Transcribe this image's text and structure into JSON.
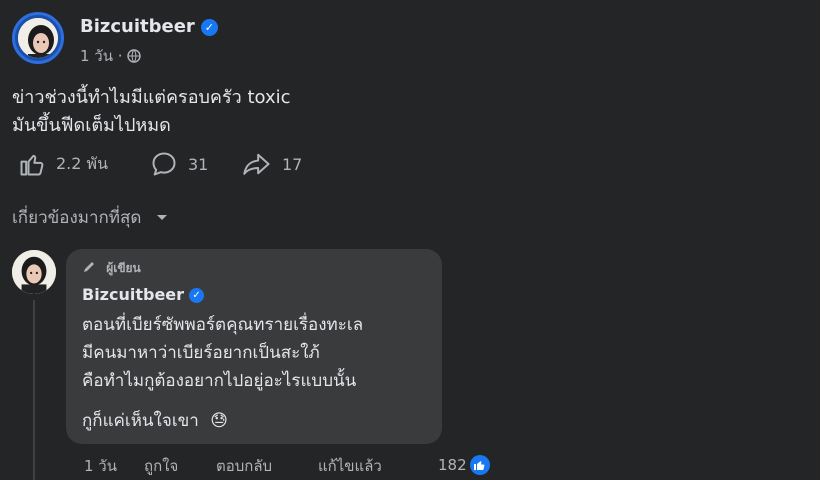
{
  "post": {
    "author": "Bizcuitbeer",
    "time": "1 วัน",
    "text_line1": "ข่าวช่วงนี้ทำไมมีแต่ครอบครัว toxic",
    "text_line2": "มันขึ้นฟีดเต็มไปหมด",
    "likes": "2.2 พัน",
    "comments": "31",
    "shares": "17"
  },
  "sort_label": "เกี่ยวข้องมากที่สุด",
  "comment": {
    "badge": "ผู้เขียน",
    "author": "Bizcuitbeer",
    "line1": "ตอนที่เบียร์ซัพพอร์ตคุณทรายเรื่องทะเล",
    "line2": "มีคนมาหาว่าเบียร์อยากเป็นสะใภ้",
    "line3": "คือทำไมกูต้องอยากไปอยู่อะไรแบบนั้น",
    "line4": "กูก็แค่เห็นใจเขา",
    "emoji": "😓",
    "time": "1 วัน",
    "like_label": "ถูกใจ",
    "reply_label": "ตอบกลับ",
    "edited_label": "แก้ไขแล้ว",
    "reaction_count": "182"
  },
  "colors": {
    "background": "#242526",
    "bubble": "#3a3b3c",
    "verified": "#1877f2",
    "text": "#e4e6eb",
    "muted": "#b0b3b8"
  }
}
